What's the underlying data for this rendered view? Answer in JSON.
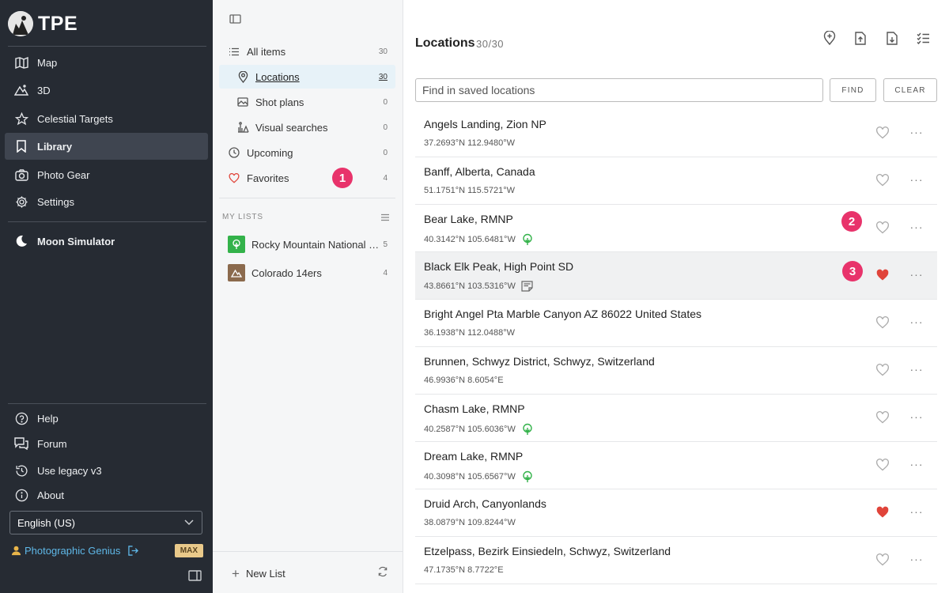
{
  "app": {
    "brand": "TPE"
  },
  "sidebar": {
    "nav": [
      {
        "label": "Map",
        "icon": "map-icon"
      },
      {
        "label": "3D",
        "icon": "mountains-icon"
      },
      {
        "label": "Celestial Targets",
        "icon": "star-icon"
      },
      {
        "label": "Library",
        "icon": "bookmark-icon",
        "active": true
      },
      {
        "label": "Photo Gear",
        "icon": "camera-icon"
      },
      {
        "label": "Settings",
        "icon": "gear-icon"
      }
    ],
    "moon_simulator": "Moon Simulator",
    "bottom_nav": [
      {
        "label": "Help",
        "icon": "question-icon"
      },
      {
        "label": "Forum",
        "icon": "chat-icon"
      },
      {
        "label": "Use legacy v3",
        "icon": "history-icon"
      },
      {
        "label": "About",
        "icon": "info-icon"
      }
    ],
    "language": "English (US)",
    "user_name": "Photographic Genius",
    "plan_badge": "MAX"
  },
  "library": {
    "items": [
      {
        "label": "All items",
        "count": "30",
        "icon": "list-icon"
      },
      {
        "label": "Locations",
        "count": "30",
        "icon": "pin-icon",
        "active": true
      },
      {
        "label": "Shot plans",
        "count": "0",
        "icon": "image-icon"
      },
      {
        "label": "Visual searches",
        "count": "0",
        "icon": "visual-search-icon"
      },
      {
        "label": "Upcoming",
        "count": "0",
        "icon": "clock-icon"
      },
      {
        "label": "Favorites",
        "count": "4",
        "icon": "heart-outline-icon"
      }
    ],
    "my_lists_heading": "MY LISTS",
    "lists": [
      {
        "label": "Rocky Mountain National …",
        "count": "5",
        "thumb_color": "#33b24a"
      },
      {
        "label": "Colorado 14ers",
        "count": "4",
        "thumb_color": "#8b6a4d"
      }
    ],
    "new_list_label": "New List"
  },
  "callouts": [
    "1",
    "2",
    "3"
  ],
  "main": {
    "title": "Locations",
    "count": "30/30",
    "search_placeholder": "Find in saved locations",
    "find_label": "FIND",
    "clear_label": "CLEAR",
    "more_label": "···",
    "rows": [
      {
        "name": "Angels Landing, Zion NP",
        "coords": "37.2693°N 112.9480°W",
        "favorite": false,
        "badge": null
      },
      {
        "name": "Banff, Alberta, Canada",
        "coords": "51.1751°N 115.5721°W",
        "favorite": false,
        "badge": null
      },
      {
        "name": "Bear Lake, RMNP",
        "coords": "40.3142°N 105.6481°W",
        "favorite": false,
        "badge": "tree"
      },
      {
        "name": "Black Elk Peak, High Point SD",
        "coords": "43.8661°N 103.5316°W",
        "favorite": true,
        "badge": "note",
        "highlight": true
      },
      {
        "name": "Bright Angel Pta Marble Canyon AZ 86022 United States",
        "coords": "36.1938°N 112.0488°W",
        "favorite": false,
        "badge": null
      },
      {
        "name": "Brunnen, Schwyz District, Schwyz, Switzerland",
        "coords": "46.9936°N 8.6054°E",
        "favorite": false,
        "badge": null
      },
      {
        "name": "Chasm Lake, RMNP",
        "coords": "40.2587°N 105.6036°W",
        "favorite": false,
        "badge": "tree"
      },
      {
        "name": "Dream Lake, RMNP",
        "coords": "40.3098°N 105.6567°W",
        "favorite": false,
        "badge": "tree"
      },
      {
        "name": "Druid Arch, Canyonlands",
        "coords": "38.0879°N 109.8244°W",
        "favorite": true,
        "badge": null
      },
      {
        "name": "Etzelpass, Bezirk Einsiedeln, Schwyz, Switzerland",
        "coords": "47.1735°N 8.7722°E",
        "favorite": false,
        "badge": null
      }
    ]
  },
  "colors": {
    "sidebar_bg": "#262b33",
    "accent_link": "#5fb8e8",
    "callout": "#e8336b",
    "heart_filled": "#e0443a",
    "tree_badge": "#33b24a"
  }
}
